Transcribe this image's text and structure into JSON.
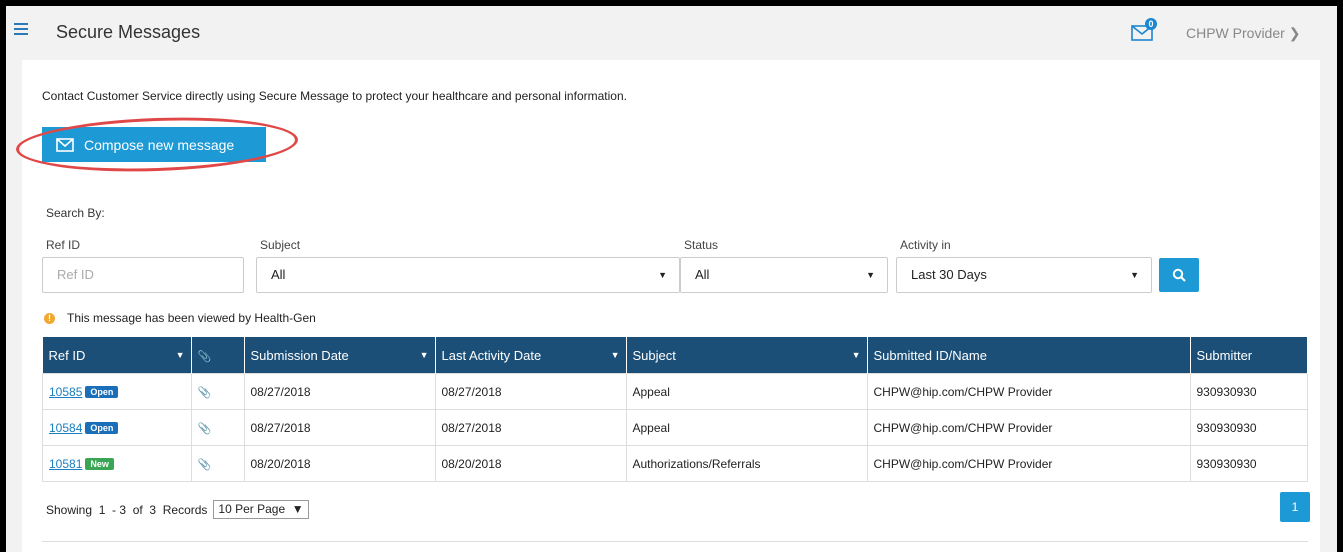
{
  "header": {
    "title": "Secure Messages",
    "mail_count": "0",
    "user_name": "CHPW Provider"
  },
  "intro_text": "Contact Customer Service directly using Secure Message to protect your healthcare and personal information.",
  "compose_label": "Compose new message",
  "search": {
    "heading": "Search By:",
    "ref_id_label": "Ref ID",
    "ref_id_placeholder": "Ref ID",
    "subject_label": "Subject",
    "subject_value": "All",
    "status_label": "Status",
    "status_value": "All",
    "activity_label": "Activity in",
    "activity_value": "Last 30 Days"
  },
  "viewed_note": "This message has been viewed by Health-Gen",
  "table": {
    "columns": [
      "Ref ID",
      "",
      "Submission Date",
      "Last Activity Date",
      "Subject",
      "Submitted ID/Name",
      "Submitter"
    ],
    "rows": [
      {
        "ref": "10585",
        "status": "Open",
        "submission": "08/27/2018",
        "last_activity": "08/27/2018",
        "subject": "Appeal",
        "submitted": "CHPW@hip.com/CHPW Provider",
        "submitter": "930930930"
      },
      {
        "ref": "10584",
        "status": "Open",
        "submission": "08/27/2018",
        "last_activity": "08/27/2018",
        "subject": "Appeal",
        "submitted": "CHPW@hip.com/CHPW Provider",
        "submitter": "930930930"
      },
      {
        "ref": "10581",
        "status": "New",
        "submission": "08/20/2018",
        "last_activity": "08/20/2018",
        "subject": "Authorizations/Referrals",
        "submitted": "CHPW@hip.com/CHPW Provider",
        "submitter": "930930930"
      }
    ]
  },
  "pagination": {
    "showing": "Showing  1  - 3  of  3  Records",
    "per_page": "10 Per Page",
    "current_page": "1"
  },
  "colors": {
    "accent": "#1d9ad6",
    "header_bg": "#1b4f78",
    "open_tag": "#1a6fb8",
    "new_tag": "#3aa655",
    "highlight": "#e04848"
  }
}
